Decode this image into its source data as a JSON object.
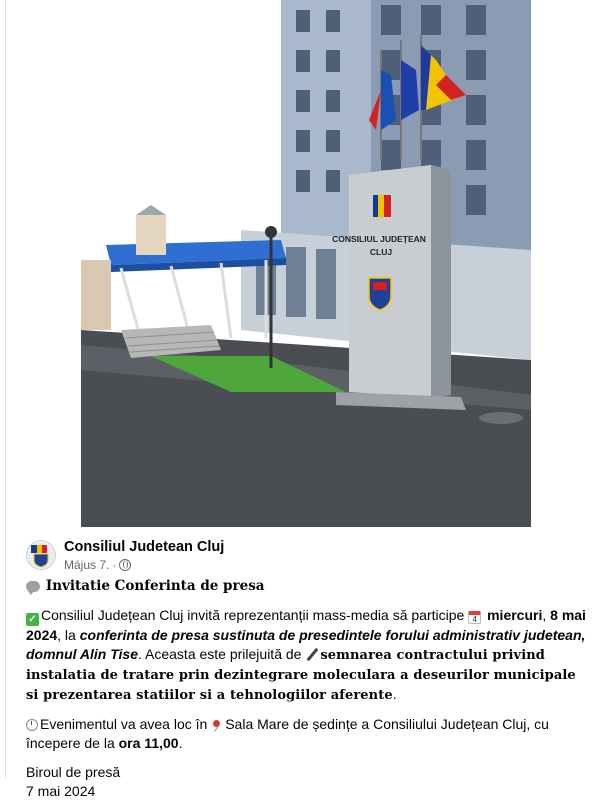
{
  "photo": {
    "sign_line1": "CONSILIUL JUDEȚEAN",
    "sign_line2": "CLUJ"
  },
  "post": {
    "page_name": "Consiliul Judetean Cluj",
    "date": "Május 7.",
    "dot": "·",
    "title": "Invitatie Conferinta de presa",
    "p1_text1": "Consiliul Județean Cluj invită reprezentanții mass-media să participe ",
    "p1_cal_day": "4",
    "p1_day": "miercuri",
    "p1_comma": ", ",
    "p1_date": "8 mai 2024",
    "p1_text2": ", la ",
    "p1_italic": "conferinta de presa sustinuta de presedintele forului administrativ judetean, domnul Alin Tise",
    "p1_text3": ". Aceasta este prilejuită de ",
    "p1_serif": "semnarea contractului privind instalatia de tratare prin dezintegrare moleculara a deseurilor municipale si prezentarea statiilor si a tehnologiilor aferente",
    "p1_end": ".",
    "p2_text1": "Evenimentul va avea loc în ",
    "p2_text2": "Sala Mare de ședințe a Consiliului Județean Cluj, cu începere de la ",
    "p2_time": "ora 11,00",
    "p2_end": ".",
    "sig1": "Biroul de presă",
    "sig2": "7 mai 2024"
  },
  "colors": {
    "text": "#050505",
    "meta": "#65676b",
    "check_green": "#3fb549"
  }
}
